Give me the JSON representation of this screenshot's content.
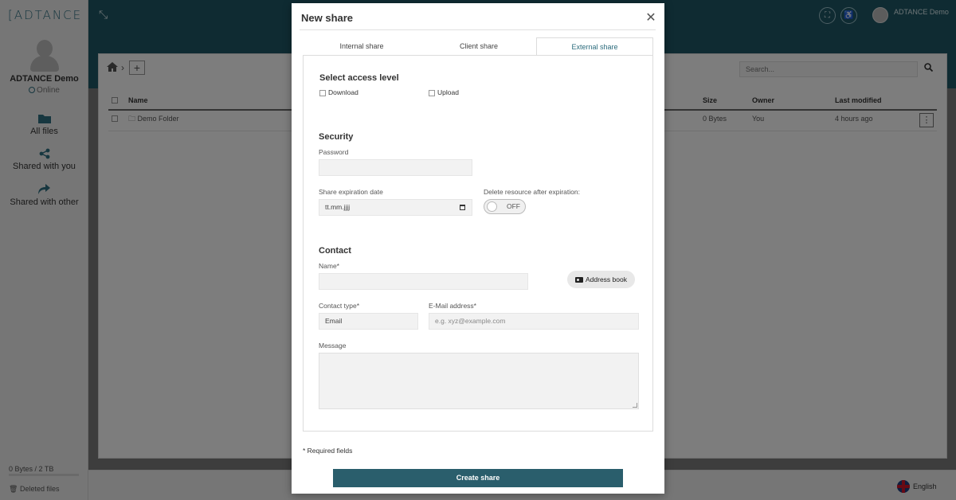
{
  "app": {
    "logo": "ADTANCE",
    "user_name": "ADTANCE Demo",
    "user_status": "Online",
    "top_user_name": "ADTANCE Demo",
    "nav": [
      {
        "label": "All files",
        "icon": "folder-icon"
      },
      {
        "label": "Shared with you",
        "icon": "share-icon"
      },
      {
        "label": "Shared with other",
        "icon": "share-forward-icon"
      }
    ],
    "storage": "0 Bytes / 2 TB",
    "deleted_files": "Deleted files",
    "search_placeholder": "Search...",
    "language": "English",
    "table": {
      "headers": {
        "name": "Name",
        "size": "Size",
        "owner": "Owner",
        "modified": "Last modified"
      },
      "rows": [
        {
          "name": "Demo Folder",
          "size": "0 Bytes",
          "owner": "You",
          "modified": "4 hours ago"
        }
      ]
    },
    "colors": {
      "header": "#1f5664",
      "accent": "#2a5e6c"
    }
  },
  "modal": {
    "title": "New share",
    "tabs": [
      {
        "label": "Internal share",
        "active": false
      },
      {
        "label": "Client share",
        "active": false
      },
      {
        "label": "External share",
        "active": true
      }
    ],
    "access": {
      "title": "Select access level",
      "download": "Download",
      "upload": "Upload"
    },
    "security": {
      "title": "Security",
      "password_label": "Password",
      "expiration_label": "Share expiration date",
      "expiration_value": "tt.mm.jjjj",
      "delete_label": "Delete resource after expiration:",
      "toggle_text": "OFF"
    },
    "contact": {
      "title": "Contact",
      "name_label": "Name*",
      "address_book": "Address book",
      "type_label": "Contact type*",
      "type_value": "Email",
      "email_label": "E-Mail address*",
      "email_placeholder": "e.g. xyz@example.com",
      "message_label": "Message"
    },
    "required_note": "* Required fields",
    "create_button": "Create share"
  }
}
